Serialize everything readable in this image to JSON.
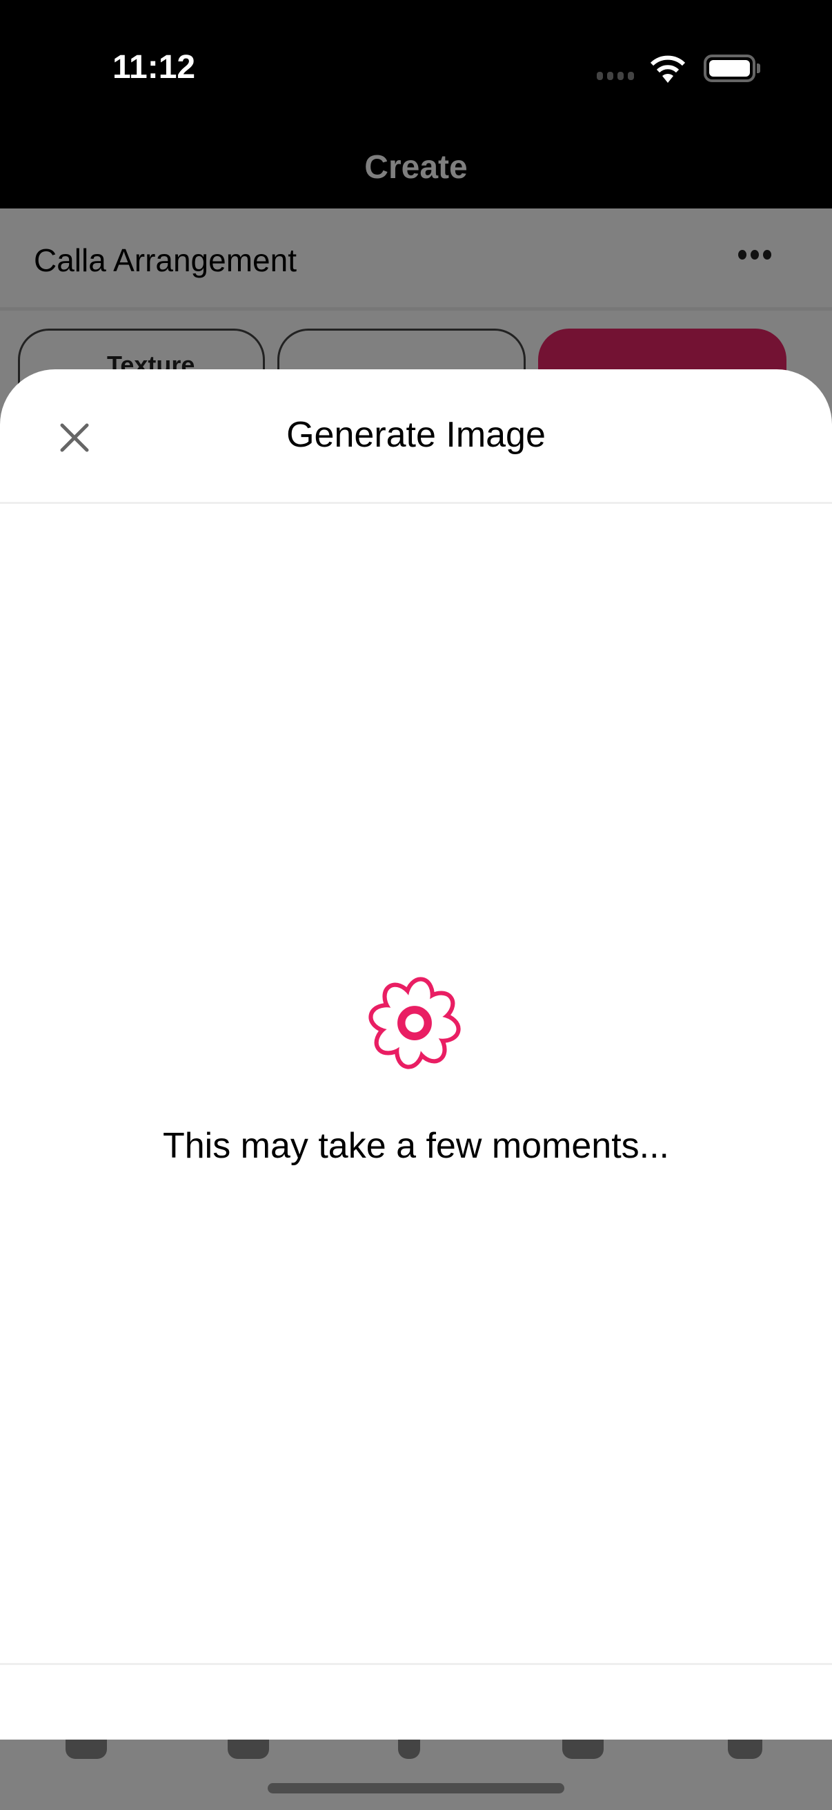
{
  "status_bar": {
    "time": "11:12",
    "wifi_icon": "wifi-icon",
    "battery_icon": "battery-icon"
  },
  "nav": {
    "title": "Create"
  },
  "project": {
    "title": "Calla Arrangement",
    "more_icon": "ellipsis-icon"
  },
  "chips": [
    {
      "label": "Texture"
    },
    {
      "label": ""
    },
    {
      "label": ""
    }
  ],
  "chip_accent": "#731233",
  "sheet": {
    "title": "Generate Image",
    "close_icon": "close-icon",
    "loading_icon": "flower-icon",
    "message": "This may take a few moments...",
    "accent": "#E91E63"
  }
}
